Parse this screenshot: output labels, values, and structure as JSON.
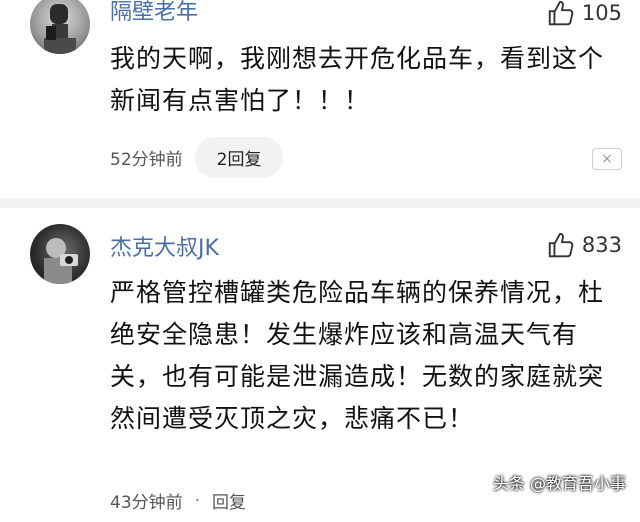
{
  "comments": [
    {
      "username": "隔壁老年",
      "likes": "105",
      "text": "我的天啊，我刚想去开危化品车，看到这个新闻有点害怕了！！！",
      "time": "52分钟前",
      "reply_label": "2回复"
    },
    {
      "username": "杰克大叔JK",
      "likes": "833",
      "text": "严格管控槽罐类危险品车辆的保养情况，杜绝安全隐患！发生爆炸应该和高温天气有关，也有可能是泄漏造成！无数的家庭就突然间遭受灭顶之灾，悲痛不已！",
      "time": "43分钟前",
      "reply_label": "回复"
    }
  ],
  "close_glyph": "×",
  "separator": "·",
  "watermark": "头条 @教育吾小事"
}
